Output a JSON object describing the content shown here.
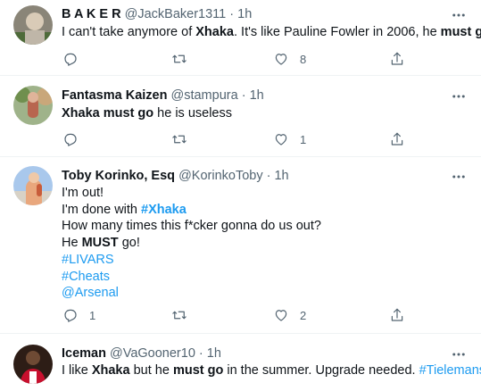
{
  "tweets": [
    {
      "name": "B A K E R",
      "handle": "@JackBaker1311",
      "dot": "·",
      "time": "1h",
      "lines": [
        [
          {
            "t": "I can't take anymore of ",
            "s": "n"
          },
          {
            "t": "Xhaka",
            "s": "b"
          },
          {
            "t": ". It's like Pauline Fowler in 2006, he ",
            "s": "n"
          },
          {
            "t": "must go",
            "s": "b"
          }
        ]
      ],
      "replies": "",
      "retweets": "",
      "likes": "8"
    },
    {
      "name": "Fantasma Kaizen",
      "handle": "@stampura",
      "dot": "·",
      "time": "1h",
      "lines": [
        [
          {
            "t": "Xhaka must go",
            "s": "b"
          },
          {
            "t": " he is useless",
            "s": "n"
          }
        ]
      ],
      "replies": "",
      "retweets": "",
      "likes": "1"
    },
    {
      "name": "Toby Korinko, Esq",
      "handle": "@KorinkoToby",
      "dot": "·",
      "time": "1h",
      "lines": [
        [
          {
            "t": "I'm out!",
            "s": "n"
          }
        ],
        [
          {
            "t": "I'm done with ",
            "s": "n"
          },
          {
            "t": "#Xhaka",
            "s": "lb"
          }
        ],
        [
          {
            "t": "How many times this f*cker gonna do us out?",
            "s": "n"
          }
        ],
        [
          {
            "t": "He ",
            "s": "n"
          },
          {
            "t": "MUST",
            "s": "b"
          },
          {
            "t": " go!",
            "s": "n"
          }
        ],
        [
          {
            "t": "#LIVARS",
            "s": "l"
          }
        ],
        [
          {
            "t": "#Cheats",
            "s": "l"
          }
        ],
        [
          {
            "t": "@Arsenal",
            "s": "l"
          }
        ]
      ],
      "replies": "1",
      "retweets": "",
      "likes": "2"
    },
    {
      "name": "Iceman",
      "handle": "@VaGooner10",
      "dot": "·",
      "time": "1h",
      "lines": [
        [
          {
            "t": "I like ",
            "s": "n"
          },
          {
            "t": "Xhaka",
            "s": "b"
          },
          {
            "t": " but he ",
            "s": "n"
          },
          {
            "t": "must go",
            "s": "b"
          },
          {
            "t": " in the summer. Upgrade needed. ",
            "s": "n"
          },
          {
            "t": "#Tielemans",
            "s": "l"
          }
        ]
      ],
      "replies": "",
      "retweets": "",
      "likes": ""
    }
  ],
  "icons": {
    "more": "more-options-icon",
    "reply": "reply-icon",
    "retweet": "retweet-icon",
    "like": "like-icon",
    "share": "share-icon"
  },
  "colors": {
    "accent": "#1d9bf0",
    "muted": "#536471",
    "text": "#0f1419",
    "divider": "#eff3f4"
  }
}
